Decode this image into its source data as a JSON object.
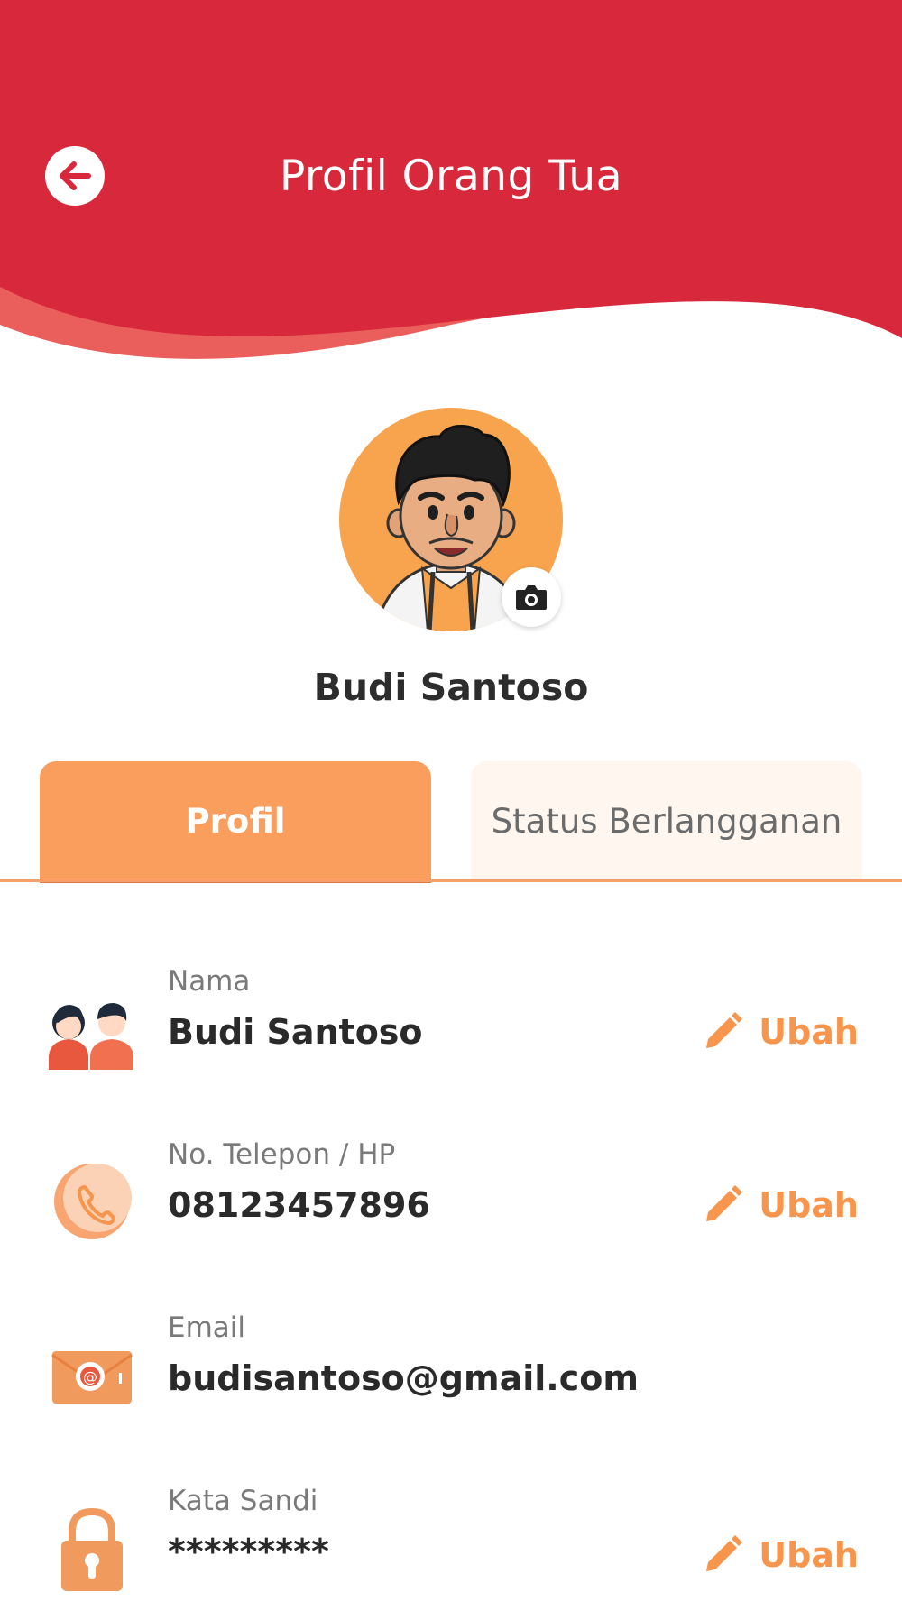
{
  "header": {
    "title": "Profil Orang Tua",
    "colors": {
      "primary": "#d8283b",
      "wave_light": "#ea5f5c"
    }
  },
  "profile": {
    "name": "Budi Santoso",
    "avatar_bg": "#f8a44e"
  },
  "tabs": [
    {
      "label": "Profil",
      "active": true
    },
    {
      "label": "Status Berlangganan",
      "active": false
    }
  ],
  "fields": {
    "nama": {
      "label": "Nama",
      "value": "Budi Santoso",
      "action": "Ubah",
      "icon": "parents-icon"
    },
    "phone": {
      "label": "No. Telepon / HP",
      "value": "08123457896",
      "action": "Ubah",
      "icon": "phone-icon"
    },
    "email": {
      "label": "Email",
      "value": "budisantoso@gmail.com",
      "icon": "email-icon"
    },
    "password": {
      "label": "Kata Sandi",
      "value": "*********",
      "action": "Ubah",
      "icon": "lock-icon"
    }
  },
  "accent": "#f7954c"
}
